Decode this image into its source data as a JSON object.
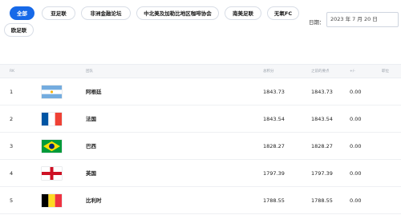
{
  "tabs": [
    {
      "label": "全部",
      "active": true
    },
    {
      "label": "亚足联",
      "active": false
    },
    {
      "label": "非洲金融论坛",
      "active": false
    },
    {
      "label": "中北美及加勒比地区咖啡协会",
      "active": false
    },
    {
      "label": "南美足联",
      "active": false
    },
    {
      "label": "无氧FC",
      "active": false
    },
    {
      "label": "欧足联",
      "active": false
    }
  ],
  "date_filter": {
    "label": "日期：",
    "value": "2023 年 7 月 20 日"
  },
  "table": {
    "headers": {
      "rank": "RK",
      "team": "团队",
      "points": "总积分",
      "prev_points": "之前的要点",
      "change": "+/-",
      "position": "职位"
    },
    "rows": [
      {
        "rank": "1",
        "flag": "argentina-flag-icon",
        "team": "阿根廷",
        "points": "1843.73",
        "prev_points": "1843.73",
        "change": "0.00"
      },
      {
        "rank": "2",
        "flag": "france-flag-icon",
        "team": "法国",
        "points": "1843.54",
        "prev_points": "1843.54",
        "change": "0.00"
      },
      {
        "rank": "3",
        "flag": "brazil-flag-icon",
        "team": "巴西",
        "points": "1828.27",
        "prev_points": "1828.27",
        "change": "0.00"
      },
      {
        "rank": "4",
        "flag": "england-flag-icon",
        "team": "英国",
        "points": "1797.39",
        "prev_points": "1797.39",
        "change": "0.00"
      },
      {
        "rank": "5",
        "flag": "belgium-flag-icon",
        "team": "比利时",
        "points": "1788.55",
        "prev_points": "1788.55",
        "change": "0.00"
      }
    ]
  },
  "colors": {
    "accent": "#1769e8",
    "header_bg": "#f6f7f9"
  }
}
